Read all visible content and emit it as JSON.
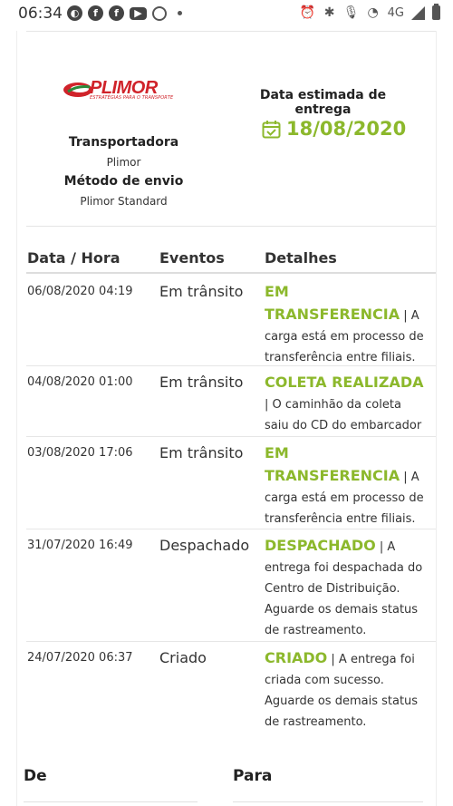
{
  "status_bar": {
    "time": "06:34",
    "network": "4G",
    "left_icons": [
      "app-circle-icon",
      "facebook-icon",
      "facebook-icon",
      "youtube-icon",
      "alarm-icon"
    ],
    "right_icons": [
      "alarm-icon",
      "bluetooth-icon",
      "mic-icon",
      "wifi-icon",
      "signal-icon",
      "battery-icon"
    ]
  },
  "shipment": {
    "logo_text": "PLIMOR",
    "logo_tagline": "ESTRATÉGIAS PARA O TRANSPORTE",
    "carrier_label": "Transportadora",
    "carrier_value": "Plimor",
    "method_label": "Método de envio",
    "method_value": "Plimor Standard",
    "estimated_label": "Data estimada de entrega",
    "estimated_date": "18/08/2020",
    "calendar_icon": "calendar-check-icon"
  },
  "table": {
    "headers": [
      "Data / Hora",
      "Eventos",
      "Detalhes"
    ],
    "rows": [
      {
        "datetime": "06/08/2020 04:19",
        "event": "Em trânsito",
        "status": "EM TRANSFERENCIA",
        "detail": " | A carga está em processo de transferência entre filiais."
      },
      {
        "datetime": "04/08/2020 01:00",
        "event": "Em trânsito",
        "status": "COLETA REALIZADA",
        "detail": " | O caminhão da coleta saiu do CD do embarcador"
      },
      {
        "datetime": "03/08/2020 17:06",
        "event": "Em trânsito",
        "status": "EM TRANSFERENCIA",
        "detail": " | A carga está em processo de transferência entre filiais."
      },
      {
        "datetime": "31/07/2020 16:49",
        "event": "Despachado",
        "status": "DESPACHADO",
        "detail": " | A entrega foi despachada do Centro de Distribuição. Aguarde os demais status de rastreamento."
      },
      {
        "datetime": "24/07/2020 06:37",
        "event": "Criado",
        "status": "CRIADO",
        "detail": " | A entrega foi criada com sucesso. Aguarde os demais status de rastreamento."
      }
    ]
  },
  "footer": {
    "from_label": "De",
    "to_label": "Para"
  },
  "colors": {
    "accent_green": "#8cb82c",
    "brand_red": "#d0232a"
  }
}
